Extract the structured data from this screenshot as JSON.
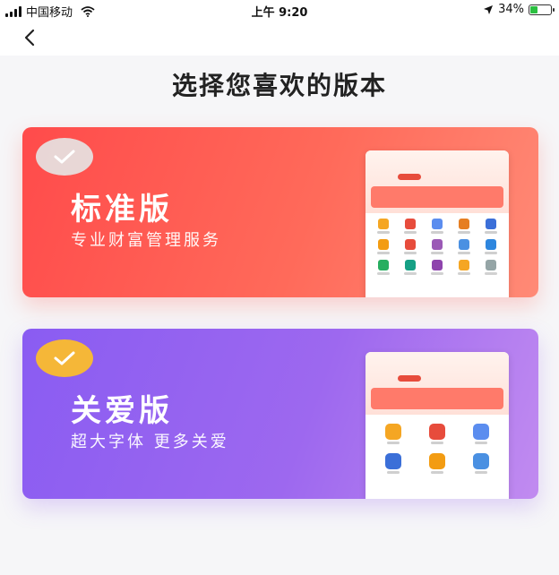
{
  "status_bar": {
    "carrier": "中国移动",
    "time": "上午 9:20",
    "battery_percent": "34%"
  },
  "header": {
    "back_icon": "chevron-left-icon"
  },
  "page": {
    "title": "选择您喜欢的版本"
  },
  "versions": [
    {
      "title": "标准版",
      "subtitle": "专业财富管理服务",
      "check_icon": "check-icon",
      "accent": "#ff5a4f"
    },
    {
      "title": "关爱版",
      "subtitle": "超大字体  更多关爱",
      "check_icon": "check-icon",
      "accent": "#9466f0",
      "check_color": "#f5b738"
    }
  ]
}
